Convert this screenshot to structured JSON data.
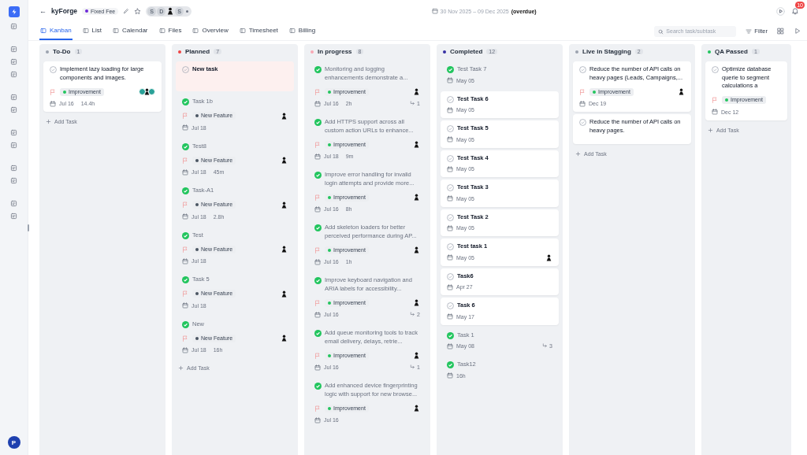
{
  "header": {
    "back": "←",
    "title": "kyForge",
    "badge": "Fixed Fee",
    "members": [
      {
        "kind": "letter",
        "initial": "S"
      },
      {
        "kind": "letter",
        "initial": "D"
      },
      {
        "kind": "person"
      },
      {
        "kind": "letter",
        "initial": "S"
      }
    ],
    "date_range": "30 Nov 2025 – 09 Dec 2025",
    "date_note": "(overdue)",
    "notifications": "10"
  },
  "tabs": [
    {
      "label": "Kanban",
      "selected": true
    },
    {
      "label": "List",
      "selected": false
    },
    {
      "label": "Calendar",
      "selected": false
    },
    {
      "label": "Files",
      "selected": false
    },
    {
      "label": "Overview",
      "selected": false
    },
    {
      "label": "Timesheet",
      "selected": false
    },
    {
      "label": "Billing",
      "selected": false
    }
  ],
  "search": {
    "placeholder": "Search task/subtask"
  },
  "filter": "Filter",
  "sidebar": {
    "user_initial": "P"
  },
  "columns": [
    {
      "name": "To-Do",
      "count": "1",
      "color": "#9ca3af",
      "add": "Add Task",
      "cards": [
        {
          "title": "Implement lazy loading for large components and images.",
          "done": false,
          "highlighted": false,
          "tag": {
            "label": "Improvement",
            "color": "#22c55e"
          },
          "assignee": {
            "kind": "group"
          },
          "date": "Jul 16",
          "duration": "14.4h"
        }
      ]
    },
    {
      "name": "Planned",
      "count": "7",
      "color": "#ef4444",
      "add": "Add Task",
      "cards": [
        {
          "title": "New task",
          "done": false,
          "highlighted": true
        },
        {
          "title": "Task 1b",
          "done": true,
          "highlighted": false,
          "tag": {
            "label": "New Feature",
            "color": "#4b5563"
          },
          "assignee": {
            "kind": "person"
          },
          "date": "Jul 18"
        },
        {
          "title": "Test8",
          "done": true,
          "highlighted": false,
          "tag": {
            "label": "New Feature",
            "color": "#4b5563"
          },
          "assignee": {
            "kind": "person"
          },
          "date": "Jul 18",
          "duration": "45m"
        },
        {
          "title": "Task-A1",
          "done": true,
          "highlighted": false,
          "tag": {
            "label": "New Feature",
            "color": "#4b5563"
          },
          "assignee": {
            "kind": "person"
          },
          "date": "Jul 18",
          "duration": "2.8h"
        },
        {
          "title": "Test",
          "done": true,
          "highlighted": false,
          "tag": {
            "label": "New Feature",
            "color": "#4b5563"
          },
          "assignee": {
            "kind": "person"
          },
          "date": "Jul 18"
        },
        {
          "title": "Task 5",
          "done": true,
          "highlighted": false,
          "tag": {
            "label": "New Feature",
            "color": "#4b5563"
          },
          "assignee": {
            "kind": "person"
          },
          "date": "Jul 18"
        },
        {
          "title": "New",
          "done": true,
          "highlighted": false,
          "tag": {
            "label": "New Feature",
            "color": "#4b5563"
          },
          "assignee": {
            "kind": "person"
          },
          "date": "Jul 18",
          "duration": "16h"
        }
      ]
    },
    {
      "name": "In progress",
      "count": "8",
      "color": "#f9a8b4",
      "cards": [
        {
          "title": "Monitoring and logging enhancements demonstrate a...",
          "done": true,
          "highlighted": false,
          "tag": {
            "label": "Improvement",
            "color": "#22c55e"
          },
          "assignee": {
            "kind": "person"
          },
          "date": "Jul 16",
          "duration": "2h",
          "subtasks": "1"
        },
        {
          "title": "Add HTTPS support across all custom action URLs to enhance...",
          "done": true,
          "highlighted": false,
          "tag": {
            "label": "Improvement",
            "color": "#22c55e"
          },
          "assignee": {
            "kind": "person"
          },
          "date": "Jul 18",
          "duration": "9m"
        },
        {
          "title": "Improve error handling for invalid login attempts and provide more...",
          "done": true,
          "highlighted": false,
          "tag": {
            "label": "Improvement",
            "color": "#22c55e"
          },
          "assignee": {
            "kind": "person"
          },
          "date": "Jul 16",
          "duration": "8h"
        },
        {
          "title": "Add skeleton loaders for better perceived performance during AP...",
          "done": true,
          "highlighted": false,
          "tag": {
            "label": "Improvement",
            "color": "#22c55e"
          },
          "assignee": {
            "kind": "person"
          },
          "date": "Jul 16",
          "duration": "1h"
        },
        {
          "title": "Improve keyboard navigation and ARIA labels for accessibility...",
          "done": true,
          "highlighted": false,
          "tag": {
            "label": "Improvement",
            "color": "#22c55e"
          },
          "assignee": {
            "kind": "person"
          },
          "date": "Jul 16",
          "subtasks": "2"
        },
        {
          "title": "Add queue monitoring tools to track email delivery, delays, retrie...",
          "done": true,
          "highlighted": false,
          "tag": {
            "label": "Improvement",
            "color": "#22c55e"
          },
          "assignee": {
            "kind": "person"
          },
          "date": "Jul 16",
          "subtasks": "1"
        },
        {
          "title": "Add enhanced device fingerprinting logic with support for new browse...",
          "done": true,
          "highlighted": false,
          "tag": {
            "label": "Improvement",
            "color": "#22c55e"
          },
          "assignee": {
            "kind": "person"
          },
          "date": "Jul 16"
        }
      ]
    },
    {
      "name": "Completed",
      "count": "12",
      "color": "#3730a3",
      "cards": [
        {
          "title": "Test Task 7",
          "done": true,
          "highlighted": false,
          "date": "May 05"
        },
        {
          "title": "Test Task 6",
          "done": false,
          "highlighted": false,
          "date": "May 05"
        },
        {
          "title": "Test Task 5",
          "done": false,
          "highlighted": false,
          "date": "May 05"
        },
        {
          "title": "Test Task 4",
          "done": false,
          "highlighted": false,
          "date": "May 05"
        },
        {
          "title": "Test Task 3",
          "done": false,
          "highlighted": false,
          "date": "May 05"
        },
        {
          "title": "Test Task 2",
          "done": false,
          "highlighted": false,
          "date": "May 05"
        },
        {
          "title": "Test task 1",
          "done": false,
          "highlighted": false,
          "assignee": {
            "kind": "person"
          },
          "date": "May 05"
        },
        {
          "title": "Task6",
          "done": false,
          "highlighted": false,
          "date": "Apr 27"
        },
        {
          "title": "Task 6",
          "done": false,
          "highlighted": false,
          "date": "May 17"
        },
        {
          "title": "Task 1",
          "done": true,
          "highlighted": false,
          "date": "May 08",
          "subtasks": "3"
        },
        {
          "title": "Task12",
          "done": true,
          "highlighted": false,
          "date": "16h"
        }
      ]
    },
    {
      "name": "Live in Stagging",
      "count": "2",
      "color": "#9ca3af",
      "add": "Add Task",
      "cards": [
        {
          "title": "Reduce the number of API calls on heavy pages (Leads, Campaigns,...",
          "done": false,
          "highlighted": false,
          "tag": {
            "label": "Improvement",
            "color": "#22c55e"
          },
          "assignee": {
            "kind": "person"
          },
          "date": "Dec 19"
        },
        {
          "title": "Reduce the number of API calls on heavy pages.",
          "done": false,
          "highlighted": false
        }
      ]
    },
    {
      "name": "QA Passed",
      "count": "1",
      "color": "#22c55e",
      "add": "Add Task",
      "cards": [
        {
          "title": "Optimize database querie to segment calculations a",
          "done": false,
          "highlighted": false,
          "tag": {
            "label": "Improvement",
            "color": "#22c55e"
          },
          "date": "Dec 12"
        }
      ]
    }
  ]
}
